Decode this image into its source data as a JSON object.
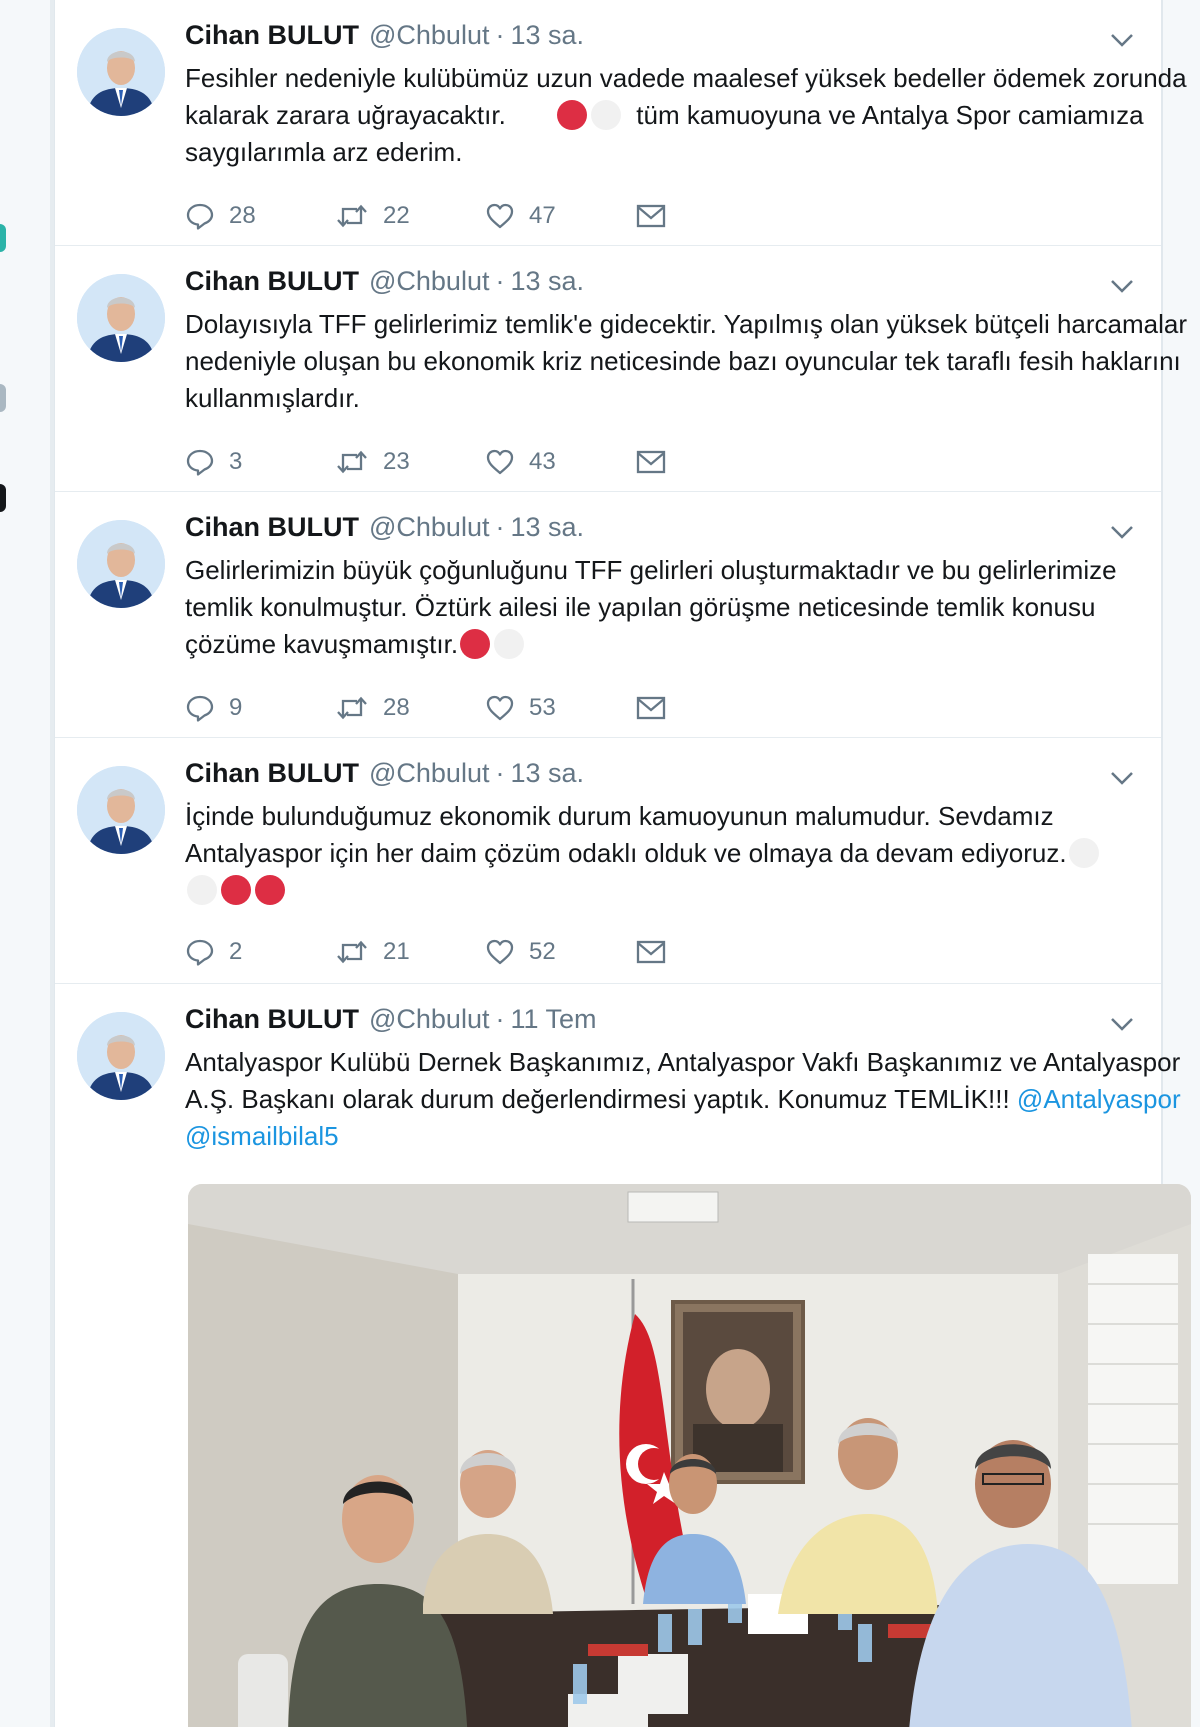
{
  "colors": {
    "page_bg": "#e6ecf0",
    "card_bg": "#ffffff",
    "name": "#14171a",
    "muted": "#657786",
    "link": "#1b95e0",
    "emoji_red": "#dd2e44"
  },
  "tweets": [
    {
      "name": "Cihan BULUT",
      "handle": "@Chbulut",
      "separator": "·",
      "time": "13 sa.",
      "text_a": "Fesihler nedeniyle kulübümüz uzun vadede maalesef yüksek bedeller ödemek zorunda kalarak zarara uğrayacaktır.",
      "text_b": "tüm kamuoyuna ve Antalya Spor camiamıza saygılarımla arz ederim.",
      "reply_count": "28",
      "retweet_count": "22",
      "like_count": "47"
    },
    {
      "name": "Cihan BULUT",
      "handle": "@Chbulut",
      "separator": "·",
      "time": "13 sa.",
      "text": "Dolayısıyla TFF gelirlerimiz temlik'e gidecektir. Yapılmış olan yüksek bütçeli harcamalar nedeniyle oluşan bu ekonomik kriz neticesinde bazı oyuncular tek taraflı fesih haklarını kullanmışlardır.",
      "reply_count": "3",
      "retweet_count": "23",
      "like_count": "43"
    },
    {
      "name": "Cihan BULUT",
      "handle": "@Chbulut",
      "separator": "·",
      "time": "13 sa.",
      "text": "Gelirlerimizin büyük çoğunluğunu TFF gelirleri oluşturmaktadır ve bu gelirlerimize temlik konulmuştur. Öztürk ailesi ile yapılan görüşme neticesinde temlik konusu çözüme kavuşmamıştır.",
      "reply_count": "9",
      "retweet_count": "28",
      "like_count": "53"
    },
    {
      "name": "Cihan BULUT",
      "handle": "@Chbulut",
      "separator": "·",
      "time": "13 sa.",
      "text": "İçinde bulunduğumuz ekonomik durum kamuoyunun malumudur. Sevdamız Antalyaspor için her daim çözüm odaklı olduk ve olmaya da devam ediyoruz.",
      "reply_count": "2",
      "retweet_count": "21",
      "like_count": "52"
    },
    {
      "name": "Cihan BULUT",
      "handle": "@Chbulut",
      "separator": "·",
      "time": "11 Tem",
      "text": "Antalyaspor Kulübü Dernek Başkanımız, Antalyaspor Vakfı Başkanımız ve Antalyaspor A.Ş. Başkanı olarak durum değerlendirmesi yaptık. Konumuz TEMLİK!!!",
      "mention_1": "@Antalyaspor",
      "mention_2": "@ismailbilal5"
    }
  ],
  "icons": {
    "reply": "reply-icon",
    "retweet": "retweet-icon",
    "like": "heart-icon",
    "dm": "envelope-icon",
    "caret": "chevron-down-icon"
  }
}
